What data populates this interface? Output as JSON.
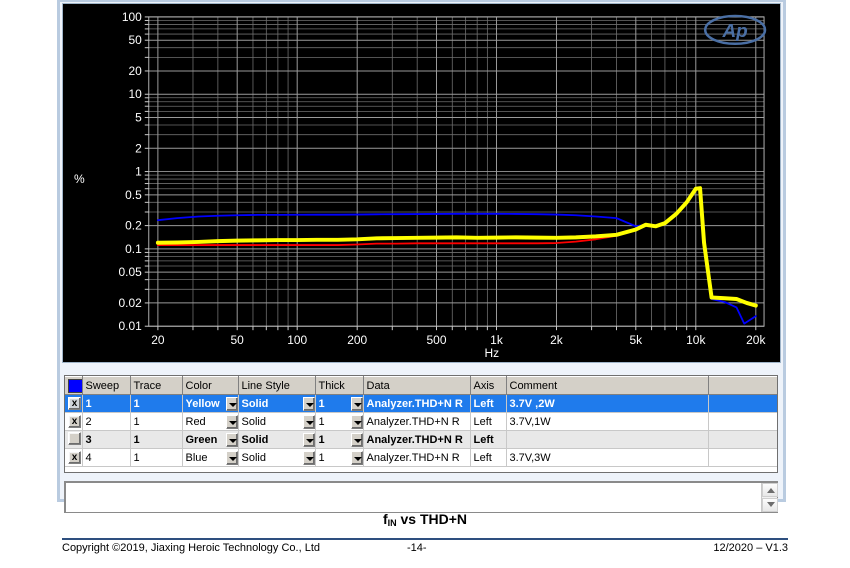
{
  "chart_data": {
    "type": "line",
    "title": "fIN vs THD+N",
    "xlabel": "Hz",
    "ylabel": "%",
    "xscale": "log",
    "yscale": "log",
    "xlim": [
      18,
      22000
    ],
    "ylim": [
      0.01,
      100
    ],
    "xticks": [
      20,
      50,
      100,
      200,
      500,
      1000,
      2000,
      5000,
      10000,
      20000
    ],
    "xticklabels": [
      "20",
      "50",
      "100",
      "200",
      "500",
      "1k",
      "2k",
      "5k",
      "10k",
      "20k"
    ],
    "yticks": [
      0.01,
      0.02,
      0.05,
      0.1,
      0.2,
      0.5,
      1,
      2,
      5,
      10,
      20,
      50,
      100
    ],
    "yticklabels": [
      "0.01",
      "0.02",
      "0.05",
      "0.1",
      "0.2",
      "0.5",
      "1",
      "2",
      "5",
      "10",
      "20",
      "50",
      "100"
    ],
    "grid": true,
    "background": "#000000",
    "gridcolor": "#808080",
    "watermark": "Ap",
    "legend_position": "none",
    "series": [
      {
        "name": "Sweep 1 - 3.7V ,2W",
        "color": "#ffff00",
        "x": [
          20,
          25,
          32,
          40,
          50,
          63,
          80,
          100,
          125,
          160,
          200,
          250,
          315,
          400,
          500,
          630,
          800,
          1000,
          1250,
          1600,
          2000,
          2500,
          3150,
          4000,
          5000,
          5600,
          6300,
          7000,
          8000,
          9000,
          10000,
          10500,
          11000,
          12000,
          14000,
          16000,
          18000,
          20000
        ],
        "values": [
          0.12,
          0.121,
          0.123,
          0.126,
          0.128,
          0.129,
          0.13,
          0.13,
          0.131,
          0.131,
          0.133,
          0.137,
          0.138,
          0.139,
          0.14,
          0.141,
          0.139,
          0.14,
          0.141,
          0.14,
          0.139,
          0.141,
          0.145,
          0.152,
          0.178,
          0.205,
          0.196,
          0.215,
          0.285,
          0.4,
          0.6,
          0.61,
          0.12,
          0.0235,
          0.023,
          0.0225,
          0.02,
          0.0185
        ]
      },
      {
        "name": "Sweep 2 - 3.7V,1W",
        "color": "#ff0000",
        "x": [
          20,
          25,
          32,
          40,
          50,
          63,
          80,
          100,
          125,
          160,
          200,
          250,
          315,
          400,
          500,
          630,
          800,
          1000,
          1250,
          1600,
          2000,
          2500,
          3150,
          4000,
          5000,
          5600,
          6300,
          7000,
          8000,
          9000,
          10000,
          10500,
          11000,
          12000,
          14000,
          16000,
          18000,
          20000
        ],
        "values": [
          0.112,
          0.112,
          0.112,
          0.112,
          0.112,
          0.112,
          0.112,
          0.112,
          0.112,
          0.112,
          0.114,
          0.117,
          0.117,
          0.118,
          0.118,
          0.118,
          0.118,
          0.118,
          0.118,
          0.118,
          0.119,
          0.124,
          0.133,
          0.148,
          0.176,
          0.203,
          0.194,
          0.213,
          0.282,
          0.398,
          0.595,
          0.605,
          0.118,
          0.0232,
          0.0228,
          0.0222,
          0.0196,
          0.018
        ]
      },
      {
        "name": "Sweep 4 - 3.7V,3W",
        "color": "#0000ff",
        "x": [
          20,
          25,
          32,
          40,
          50,
          63,
          80,
          100,
          125,
          160,
          200,
          250,
          315,
          400,
          500,
          630,
          800,
          1000,
          1250,
          1600,
          2000,
          2500,
          3150,
          4000,
          5000,
          5600,
          6300,
          7000,
          8000,
          9000,
          10000,
          10500,
          11000,
          12000,
          14000,
          16000,
          17500,
          20000
        ],
        "values": [
          0.235,
          0.25,
          0.262,
          0.268,
          0.272,
          0.275,
          0.275,
          0.276,
          0.277,
          0.277,
          0.278,
          0.28,
          0.281,
          0.282,
          0.283,
          0.284,
          0.284,
          0.284,
          0.283,
          0.281,
          0.278,
          0.272,
          0.262,
          0.25,
          0.196,
          0.205,
          0.196,
          0.215,
          0.283,
          0.398,
          0.593,
          0.603,
          0.116,
          0.0225,
          0.0205,
          0.0175,
          0.0108,
          0.0135
        ]
      }
    ]
  },
  "plot": {
    "watermark_label": "Ap",
    "y_axis_unit": "%",
    "x_axis_title": "Hz"
  },
  "sweep_table": {
    "columns": [
      "",
      "Sweep",
      "Trace",
      "Color",
      "Line Style",
      "Thick",
      "Data",
      "Axis",
      "Comment",
      ""
    ],
    "rows": [
      {
        "enabled": "x",
        "sweep": "1",
        "trace": "1",
        "color": "Yellow",
        "line_style": "Solid",
        "thick": "1",
        "data": "Analyzer.THD+N R",
        "axis": "Left",
        "comment": "3.7V ,2W",
        "state": "selected"
      },
      {
        "enabled": "x",
        "sweep": "2",
        "trace": "1",
        "color": "Red",
        "line_style": "Solid",
        "thick": "1",
        "data": "Analyzer.THD+N R",
        "axis": "Left",
        "comment": "3.7V,1W",
        "state": "normal"
      },
      {
        "enabled": "",
        "sweep": "3",
        "trace": "1",
        "color": "Green",
        "line_style": "Solid",
        "thick": "1",
        "data": "Analyzer.THD+N R",
        "axis": "Left",
        "comment": "",
        "state": "alt"
      },
      {
        "enabled": "x",
        "sweep": "4",
        "trace": "1",
        "color": "Blue",
        "line_style": "Solid",
        "thick": "1",
        "data": "Analyzer.THD+N R",
        "axis": "Left",
        "comment": "3.7V,3W",
        "state": "normal"
      }
    ]
  },
  "comment_box": {
    "value": "",
    "placeholder": ""
  },
  "caption": {
    "prefix": "f",
    "subscript": "IN",
    "suffix": " vs THD+N"
  },
  "footer": {
    "copyright": "Copyright ©2019, Jiaxing Heroic Technology Co., Ltd",
    "page": "-14-",
    "version": "12/2020 – V1.3"
  },
  "colors": {
    "accent_blue": "#1f7bec",
    "yellow": "#ffff00",
    "red": "#ff0000",
    "blue": "#0000ff",
    "panel": "#eef3fa",
    "footer_rule": "#2e4f7f"
  }
}
